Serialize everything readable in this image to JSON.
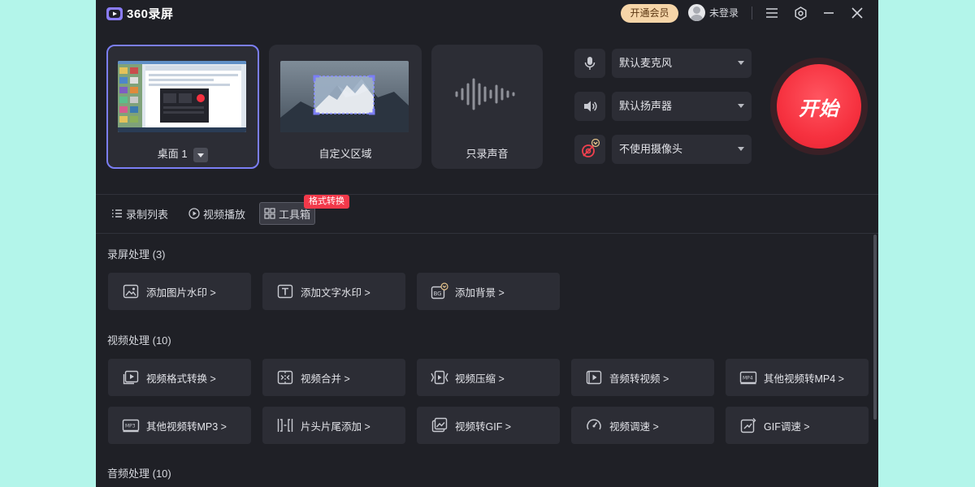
{
  "app": {
    "title": "360录屏"
  },
  "header": {
    "vip_label": "开通会员",
    "user_label": "未登录"
  },
  "sources": [
    {
      "label": "桌面 1",
      "selected": true
    },
    {
      "label": "自定义区域"
    },
    {
      "label": "只录声音"
    }
  ],
  "devices": {
    "microphone": "默认麦克风",
    "speaker": "默认扬声器",
    "camera": "不使用摄像头"
  },
  "start_label": "开始",
  "tabs": [
    {
      "label": "录制列表"
    },
    {
      "label": "视频播放"
    },
    {
      "label": "工具箱",
      "active": true,
      "badge": "格式转换"
    }
  ],
  "sections": [
    {
      "title": "录屏处理 (3)",
      "tools": [
        "添加图片水印 >",
        "添加文字水印 >",
        "添加背景 >"
      ]
    },
    {
      "title": "视频处理 (10)",
      "tools": [
        "视频格式转换 >",
        "视频合并 >",
        "视频压缩 >",
        "音频转视频 >",
        "其他视频转MP4 >",
        "其他视频转MP3 >",
        "片头片尾添加 >",
        "视频转GIF >",
        "视频调速 >",
        "GIF调速 >"
      ]
    },
    {
      "title": "音频处理 (10)",
      "tools": []
    }
  ],
  "colors": {
    "background": "#1f2026",
    "card": "#2c2d35",
    "accent": "#7b7ef5",
    "start": "#f6313f",
    "vip": "#f6d5a8"
  }
}
